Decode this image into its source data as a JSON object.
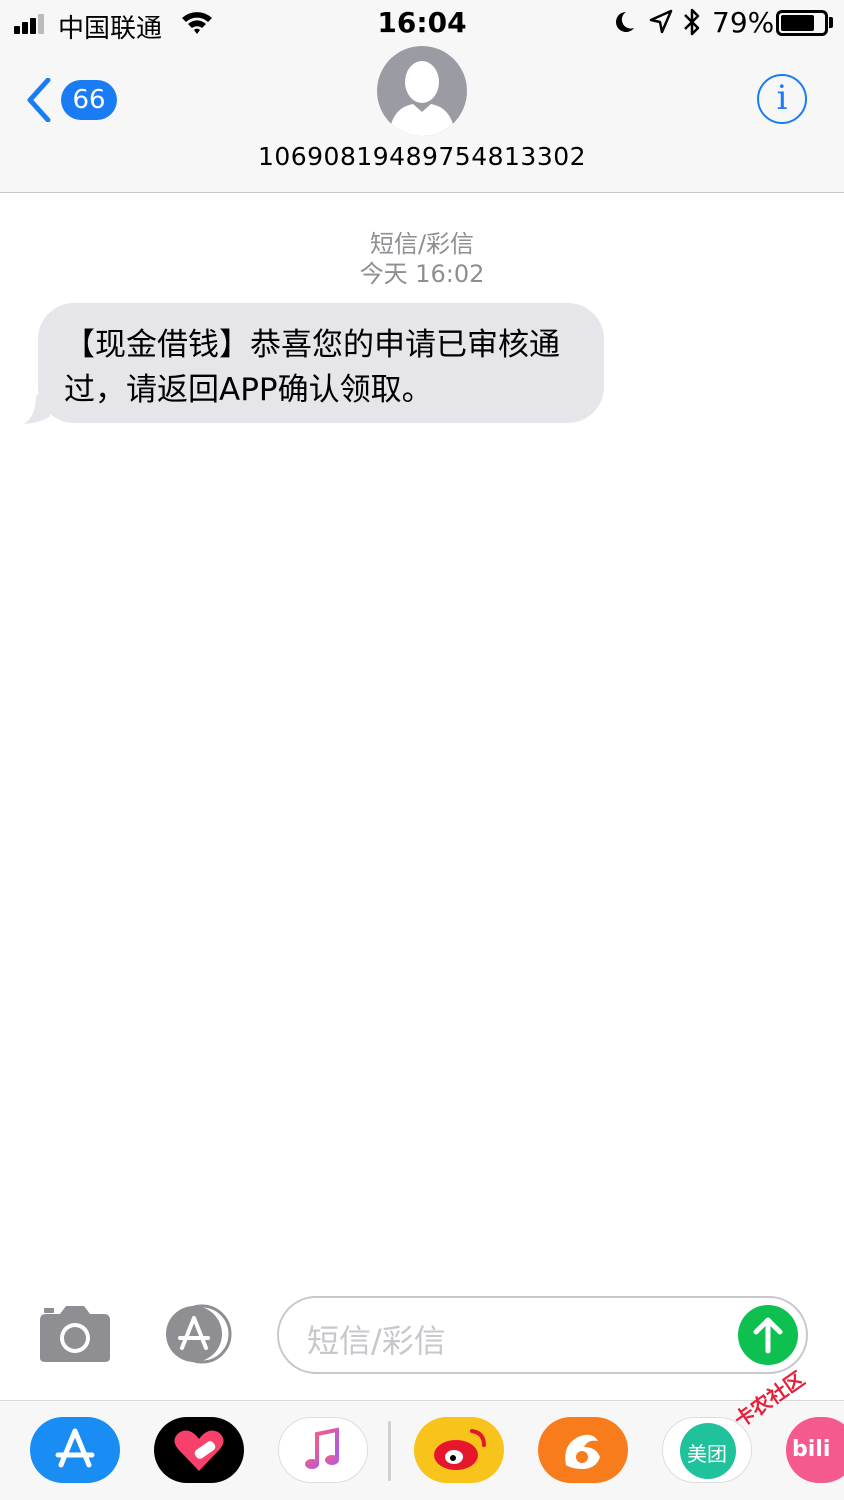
{
  "status_bar": {
    "carrier": "中国联通",
    "time": "16:04",
    "battery_percent": "79%",
    "battery_level": 0.79
  },
  "header": {
    "back_badge": "66",
    "contact": "10690819489754813302"
  },
  "conversation": {
    "message_type": "短信/彩信",
    "timestamp": "今天 16:02",
    "messages": [
      {
        "direction": "incoming",
        "text": "【现金借钱】恭喜您的申请已审核通过，请返回APP确认领取。"
      }
    ]
  },
  "input": {
    "placeholder": "短信/彩信"
  },
  "app_drawer": {
    "apps": [
      {
        "name": "app-store",
        "icon": "app-store-icon"
      },
      {
        "name": "heart-sticker",
        "icon": "heart-icon"
      },
      {
        "name": "music",
        "icon": "music-note-icon"
      },
      {
        "name": "weibo",
        "icon": "weibo-icon"
      },
      {
        "name": "uc-browser",
        "icon": "squirrel-icon"
      },
      {
        "name": "meituan",
        "icon": "meituan-icon",
        "label": "美团"
      },
      {
        "name": "bilibili",
        "icon": "bilibili-icon",
        "label": "bili"
      }
    ]
  },
  "watermark": "卡农社区",
  "colors": {
    "accent": "#1a7cf5",
    "bubble": "#e5e5ea",
    "send": "#0dc04f"
  }
}
